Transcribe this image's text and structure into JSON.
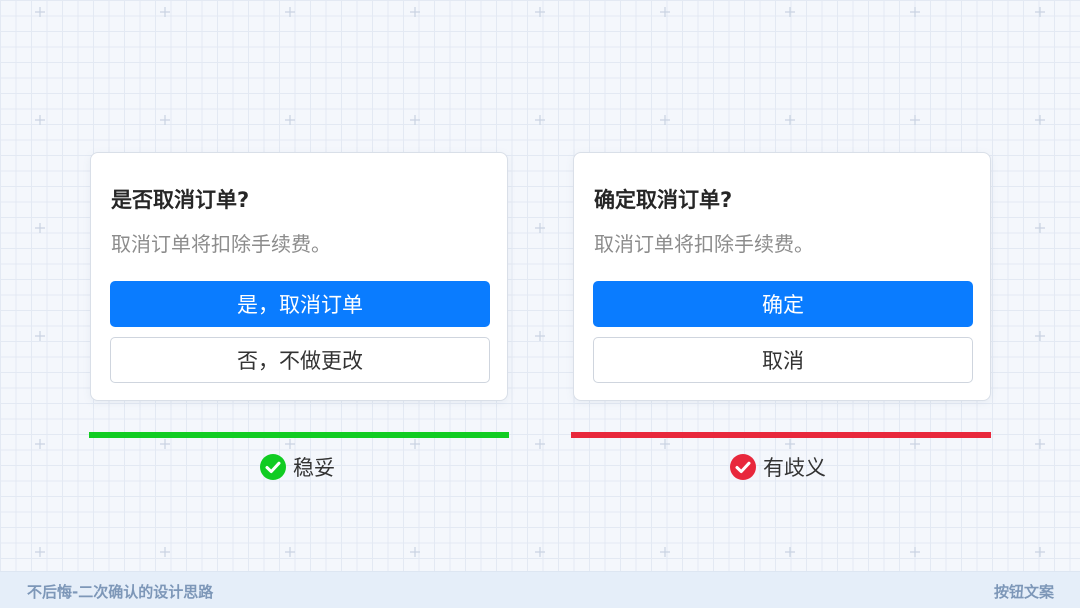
{
  "dialogs": {
    "left": {
      "title": "是否取消订单?",
      "message": "取消订单将扣除手续费。",
      "primary_label": "是，取消订单",
      "secondary_label": "否，不做更改"
    },
    "right": {
      "title": "确定取消订单?",
      "message": "取消订单将扣除手续费。",
      "primary_label": "确定",
      "secondary_label": "取消"
    }
  },
  "verdicts": {
    "left": {
      "label": "稳妥",
      "icon": "check-circle-icon",
      "color": "#11cc22"
    },
    "right": {
      "label": "有歧义",
      "icon": "check-circle-icon",
      "color": "#e8283c"
    }
  },
  "colors": {
    "primary_button": "#0a7cff",
    "good": "#11cc22",
    "bad": "#e8283c",
    "footer_text": "#7d97b8"
  },
  "footer": {
    "left_text": "不后悔-二次确认的设计思路",
    "right_text": "按钮文案"
  }
}
